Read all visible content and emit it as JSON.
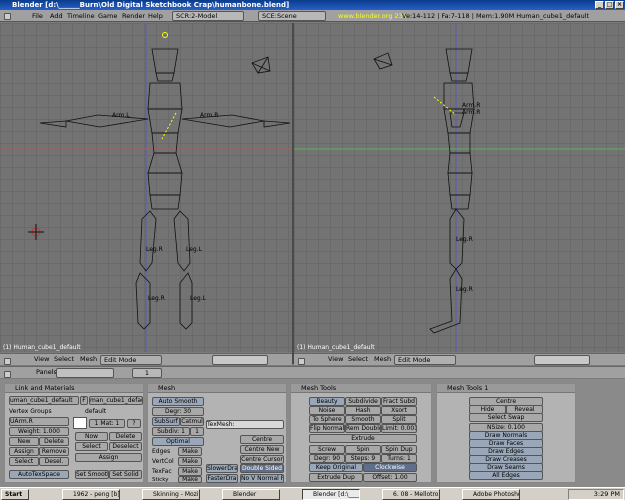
{
  "window": {
    "title": "Blender [d:\\______Burn\\Old Digital Sketchbook Crap\\humanbone.blend]"
  },
  "menu": {
    "items": [
      "File",
      "Add",
      "Timeline",
      "Game",
      "Render",
      "Help"
    ]
  },
  "infobar": {
    "screen": "SCR:2-Model",
    "scene": "SCE:Scene",
    "website": "www.blender.org 234",
    "stats": "Ve:14-112 | Fa:7-118 | Mem:1.90M Human_cube1_default"
  },
  "viewports": {
    "left": {
      "label": "(1) Human_cube1_default",
      "bones": [
        "Arm.L",
        "Arm.R",
        "Leg.R",
        "Leg.L",
        "Leg.R",
        "Leg.L"
      ]
    },
    "right": {
      "label": "(1) Human_cube1_default",
      "bones": [
        "Arm.R",
        "Arm.R",
        "Leg.R",
        "Leg.R"
      ]
    }
  },
  "viewheader": {
    "view": "View",
    "select": "Select",
    "mesh": "Mesh",
    "mode": "Edit Mode"
  },
  "buttonsheader": {
    "panels": "Panels",
    "frame": "1"
  },
  "panel_link": {
    "title": "Link and Materials",
    "me_name": "uman_cube1_default",
    "f": "F",
    "ob_name": "man_cube1_default",
    "vertex_groups_label": "Vertex Groups",
    "vgroup": "UArm.R",
    "weight": "Weight: 1.000",
    "new": "New",
    "delete": "Delete",
    "assign": "Assign",
    "remove": "Remove",
    "select": "Select",
    "deselect": "Desel.",
    "mat_label": "default",
    "mat_count": "1 Mat: 1",
    "mat_q": "?",
    "mat_new": "Now",
    "mat_delete": "Delete",
    "mat_select": "Select",
    "mat_deselect": "Deselect",
    "mat_assign": "Assign",
    "autotex": "AutoTexSpace",
    "set_smooth": "Set Smooth",
    "set_solid": "Set Solid"
  },
  "panel_mesh": {
    "title": "Mesh",
    "auto_smooth": "Auto Smooth",
    "degr": "Degr: 30",
    "subsurf": "SubSurf",
    "catmull": "Catmul",
    "subdiv": "Subdiv: 1",
    "subdiv_r": "1",
    "optimal": "Optimal",
    "texmesh": "TexMesh:",
    "edges": "Edges",
    "vertcol": "VertCol",
    "texface": "TexFac",
    "sticky": "Sticky",
    "make": "Make",
    "centre": "Centre",
    "centre_new": "Centre New",
    "centre_cursor": "Centre Cursor",
    "slower_draw": "SlowerDra",
    "faster_draw": "FasterDra",
    "double_sided": "Double Sided",
    "no_v_normal": "No V Normal Fl"
  },
  "panel_tools": {
    "title": "Mesh Tools",
    "beauty": "Beauty",
    "subdivide": "Subdivide",
    "fract_subd": "Fract Subd",
    "noise": "Noise",
    "hash": "Hash",
    "xsort": "Xsort",
    "to_sphere": "To Sphere",
    "smooth": "Smooth",
    "split": "Split",
    "flip_normal": "Flip Normal",
    "rem_doubles": "Rem Double",
    "limit": "Limit: 0.001",
    "extrude": "Extrude",
    "screw": "Screw",
    "spin": "Spin",
    "spin_dup": "Spin Dup",
    "degr": "Degr: 90",
    "steps": "Steps: 9",
    "turns": "Turns: 1",
    "keep_original": "Keep Original",
    "clockwise": "Clockwise",
    "extrude_dup": "Extrude Dup",
    "offset": "Offset: 1.00"
  },
  "panel_tools1": {
    "title": "Mesh Tools 1",
    "centre": "Centre",
    "hide": "Hide",
    "reveal": "Reveal",
    "select_swap": "Select Swap",
    "nsize": "NSize: 0.100",
    "draw_normals": "Draw Normals",
    "draw_faces": "Draw Faces",
    "draw_edges": "Draw Edges",
    "draw_creases": "Draw Creases",
    "draw_seams": "Draw Seams",
    "all_edges": "All Edges"
  },
  "taskbar": {
    "start": "Start",
    "tasks": [
      "1962 - peng [b]",
      "Skinning - Mozilla",
      "Blender",
      "Blender [d:\\______Bu",
      "6. 08 - Mellotron - Winamp",
      "Adobe Photoshop"
    ],
    "clock": "3:29 PM"
  },
  "colors": {
    "viewport": "#737373",
    "panel": "#b3b3b3",
    "header": "#a0a0a0",
    "titlebar": "#0b3c8c"
  }
}
